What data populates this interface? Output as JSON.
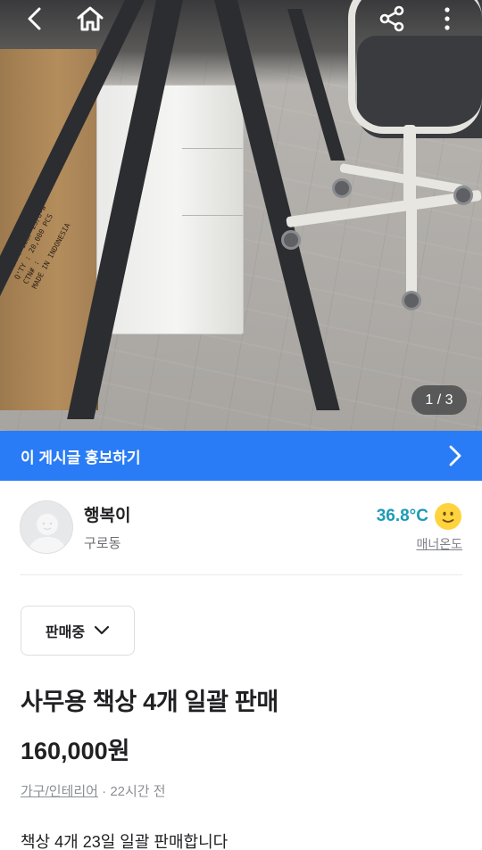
{
  "photo": {
    "counter": "1 / 3",
    "box_label": "ITEM : IBSF-25/8-W\nQ'TY : 20,000 PCS\nCTN# :\nMADE IN INDONESIA"
  },
  "topbar": {
    "back_icon": "chevron-left-icon",
    "home_icon": "home-icon",
    "share_icon": "share-icon",
    "more_icon": "more-vertical-icon"
  },
  "promo": {
    "label": "이 게시글 홍보하기",
    "color": "#2a7cf6"
  },
  "seller": {
    "name": "행복이",
    "location": "구로동",
    "temperature": "36.8°C",
    "temperature_color": "#1c9bb7",
    "manner_label": "매너온도"
  },
  "status": {
    "label": "판매중"
  },
  "post": {
    "title": "사무용 책상 4개 일괄 판매",
    "price": "160,000원",
    "category": "가구/인테리어",
    "separator": " · ",
    "time": "22시간 전",
    "body": "책상 4개 23일 일괄 판매합니다"
  }
}
